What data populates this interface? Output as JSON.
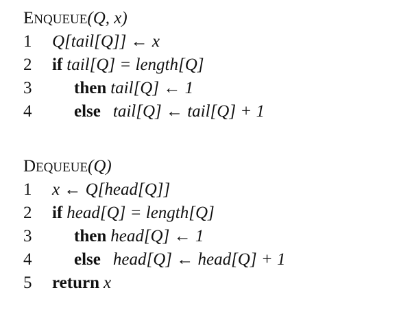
{
  "enqueue": {
    "name_initial": "E",
    "name_rest": "NQUEUE",
    "signature": "(Q, x)",
    "lines": [
      {
        "num": "1",
        "keyword": "",
        "expr": "Q[tail[Q]] ← x"
      },
      {
        "num": "2",
        "keyword": "if",
        "expr": "tail[Q] = length[Q]"
      },
      {
        "num": "3",
        "keyword": "then",
        "expr": "tail[Q] ← 1"
      },
      {
        "num": "4",
        "keyword": "else",
        "expr": "tail[Q] ← tail[Q] + 1"
      }
    ]
  },
  "dequeue": {
    "name_initial": "D",
    "name_rest": "EQUEUE",
    "signature": "(Q)",
    "lines": [
      {
        "num": "1",
        "keyword": "",
        "expr": "x ← Q[head[Q]]"
      },
      {
        "num": "2",
        "keyword": "if",
        "expr": "head[Q] = length[Q]"
      },
      {
        "num": "3",
        "keyword": "then",
        "expr": "head[Q] ← 1"
      },
      {
        "num": "4",
        "keyword": "else",
        "expr": "head[Q] ← head[Q] + 1"
      },
      {
        "num": "5",
        "keyword": "return",
        "expr": "x"
      }
    ]
  }
}
